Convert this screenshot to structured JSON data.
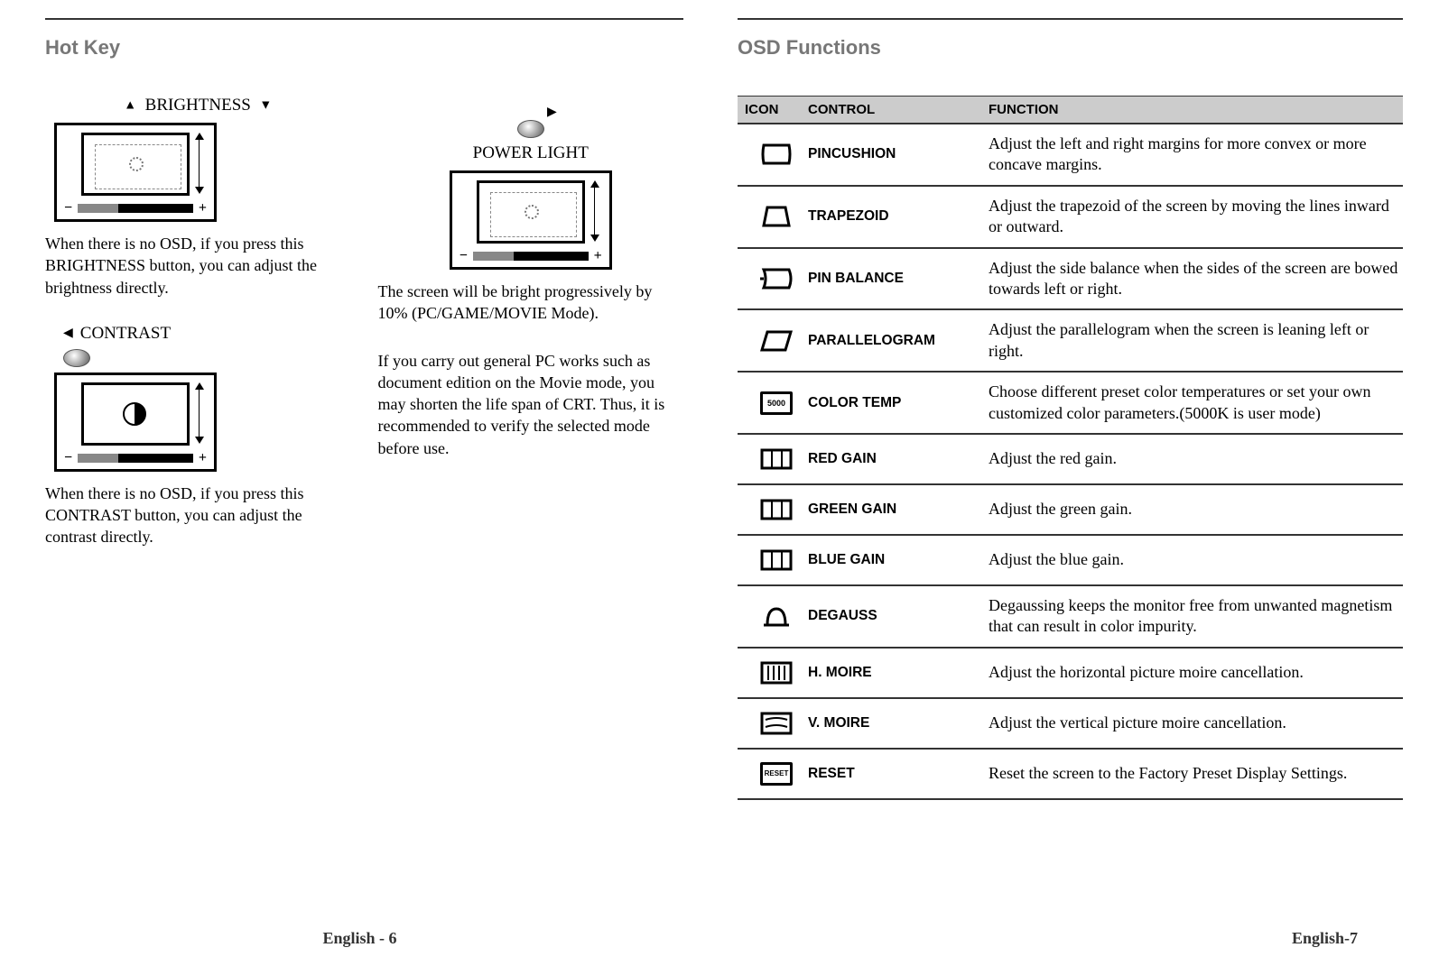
{
  "leftPage": {
    "title": "Hot Key",
    "brightness": {
      "label": "BRIGHTNESS",
      "desc": "When there is no OSD, if you press this BRIGHTNESS button, you can adjust the brightness directly."
    },
    "contrast": {
      "label": "CONTRAST",
      "desc": "When there is no OSD, if you press this CONTRAST button, you can adjust the contrast directly."
    },
    "powerLight": {
      "label": "POWER LIGHT",
      "desc1": "The screen will be bright progressively by 10% (PC/GAME/MOVIE Mode).",
      "desc2": "If you carry out general PC works such as document edition on the Movie mode, you may shorten the life span of CRT. Thus, it is recommended to verify the selected mode before use."
    },
    "pageNum": "English - 6"
  },
  "rightPage": {
    "title": "OSD Functions",
    "headers": {
      "icon": "ICON",
      "control": "CONTROL",
      "func": "FUNCTION"
    },
    "rows": [
      {
        "control": "PINCUSHION",
        "func": "Adjust the left and right margins for more convex or more concave margins.",
        "icon": "pincushion"
      },
      {
        "control": "TRAPEZOID",
        "func": "Adjust the trapezoid of the screen by moving the lines inward or outward.",
        "icon": "trapezoid"
      },
      {
        "control": "PIN BALANCE",
        "func": "Adjust the side balance when the sides of the screen are bowed towards left or right.",
        "icon": "pinbalance"
      },
      {
        "control": "PARALLELOGRAM",
        "func": "Adjust the parallelogram when the screen is leaning left or right.",
        "icon": "parallelogram"
      },
      {
        "control": "COLOR TEMP",
        "func": "Choose different preset color temperatures or set your own customized color parameters.(5000K is user mode)",
        "icon": "colortemp"
      },
      {
        "control": "RED GAIN",
        "func": "Adjust the red gain.",
        "icon": "redgain"
      },
      {
        "control": "GREEN GAIN",
        "func": "Adjust the green gain.",
        "icon": "greengain"
      },
      {
        "control": "BLUE GAIN",
        "func": "Adjust the blue gain.",
        "icon": "bluegain"
      },
      {
        "control": "DEGAUSS",
        "func": "Degaussing keeps the monitor free from unwanted magnetism that can result in color impurity.",
        "icon": "degauss"
      },
      {
        "control": "H. MOIRE",
        "func": "Adjust the horizontal picture moire cancellation.",
        "icon": "hmoire"
      },
      {
        "control": "V. MOIRE",
        "func": "Adjust the vertical picture moire cancellation.",
        "icon": "vmoire"
      },
      {
        "control": "RESET",
        "func": "Reset the screen to the Factory Preset Display Settings.",
        "icon": "reset"
      }
    ],
    "iconText": {
      "colortemp": "5000",
      "reset": "RESET"
    },
    "pageNum": "English-7"
  }
}
